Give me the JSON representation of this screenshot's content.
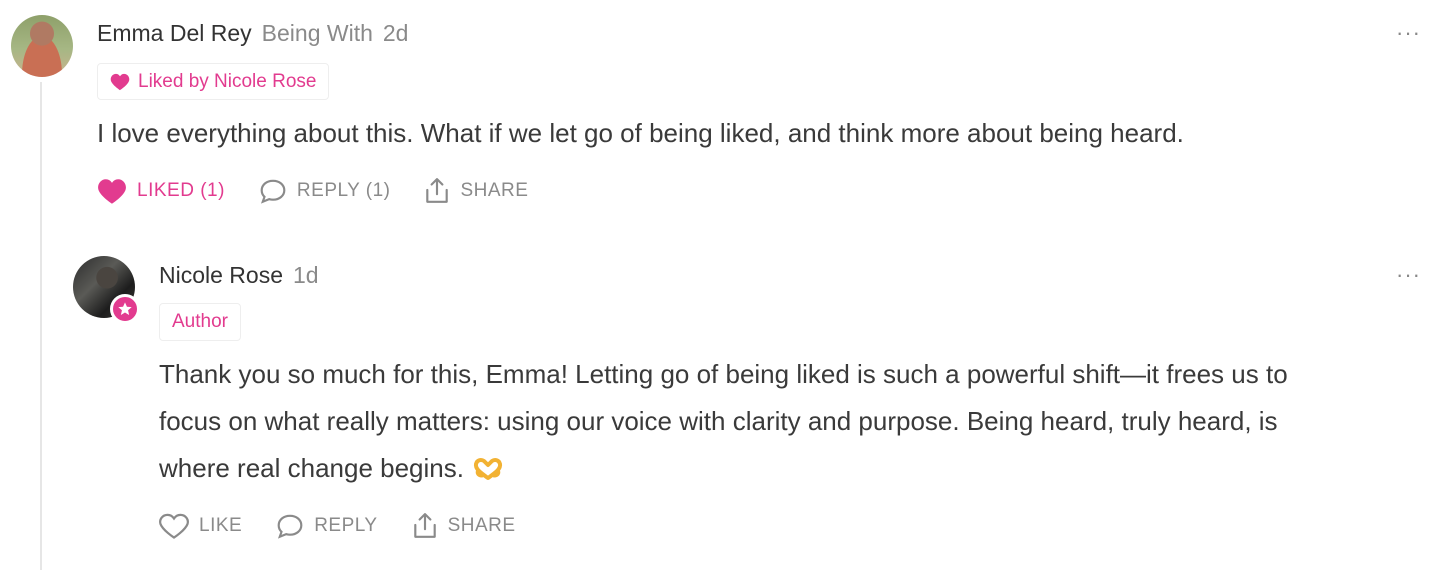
{
  "comment": {
    "author": "Emma Del Rey",
    "publication": "Being With",
    "age": "2d",
    "liked_badge": "Liked by Nicole Rose",
    "text": "I love everything about this. What if we let go of being liked, and think more about being heard.",
    "actions": {
      "like": "LIKED (1)",
      "reply": "REPLY (1)",
      "share": "SHARE"
    },
    "more": "···"
  },
  "reply": {
    "author": "Nicole Rose",
    "age": "1d",
    "role_badge": "Author",
    "text_lines": [
      "Thank you so much for this, Emma! Letting go of being liked is such a powerful shift—it frees us to",
      "focus on what really matters: using our voice with clarity and purpose. Being heard, truly heard, is",
      "where real change begins."
    ],
    "actions": {
      "like": "LIKE",
      "reply": "REPLY",
      "share": "SHARE"
    },
    "more": "···"
  },
  "colors": {
    "accent": "#e23b8f",
    "muted": "#8a8a8a",
    "text": "#3a3a3a"
  },
  "icons": [
    "heart-icon",
    "speech-bubble-icon",
    "share-icon",
    "star-icon",
    "heart-hands-emoji",
    "more-icon"
  ]
}
